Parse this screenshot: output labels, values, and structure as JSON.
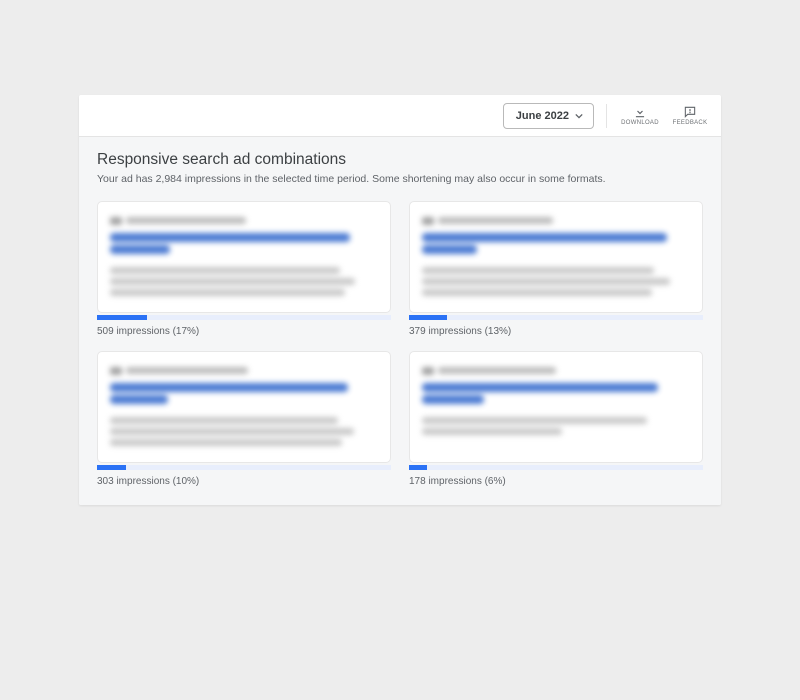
{
  "topbar": {
    "date_label": "June 2022",
    "download_label": "DOWNLOAD",
    "feedback_label": "FEEDBACK"
  },
  "header": {
    "title": "Responsive search ad combinations",
    "subtitle": "Your ad has 2,984 impressions in the selected time period. Some shortening may also occur in some formats."
  },
  "cards": [
    {
      "caption": "509 impressions (17%)",
      "bar_pct": 17
    },
    {
      "caption": "379 impressions (13%)",
      "bar_pct": 13
    },
    {
      "caption": "303 impressions (10%)",
      "bar_pct": 10
    },
    {
      "caption": "178 impressions (6%)",
      "bar_pct": 6
    }
  ]
}
